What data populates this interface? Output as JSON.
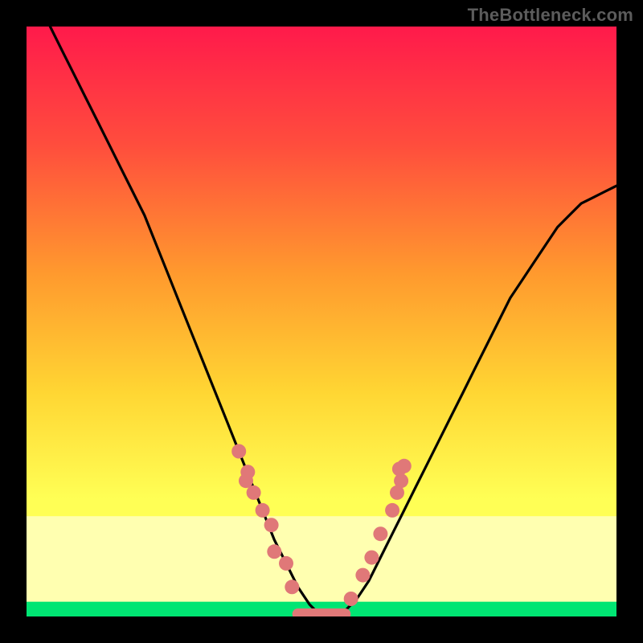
{
  "watermark": "TheBottleneck.com",
  "colors": {
    "frame_bg": "#000000",
    "grad_top": "#ff1a4b",
    "grad_mid_hi": "#ff7a33",
    "grad_mid": "#ffd633",
    "grad_low_yellow": "#ffff66",
    "grad_pale": "#ffffcc",
    "grad_green": "#00e573",
    "curve_stroke": "#000000",
    "band_stroke": "#e06e6e",
    "band_fill": "#e07878"
  },
  "chart_data": {
    "type": "line",
    "title": "",
    "xlabel": "",
    "ylabel": "",
    "xlim": [
      0,
      100
    ],
    "ylim": [
      0,
      100
    ],
    "grid": false,
    "legend": false,
    "series": [
      {
        "name": "bottleneck-curve",
        "x": [
          4,
          6,
          8,
          10,
          12,
          14,
          16,
          18,
          20,
          22,
          24,
          26,
          28,
          30,
          32,
          34,
          36,
          38,
          40,
          42,
          44,
          46,
          48,
          50,
          52,
          54,
          56,
          58,
          60,
          62,
          64,
          66,
          68,
          70,
          72,
          74,
          76,
          78,
          80,
          82,
          84,
          86,
          88,
          90,
          92,
          94,
          96,
          98,
          100
        ],
        "y": [
          100,
          96,
          92,
          88,
          84,
          80,
          76,
          72,
          68,
          63,
          58,
          53,
          48,
          43,
          38,
          33,
          28,
          23,
          18,
          13,
          9,
          5,
          2,
          0,
          0,
          1,
          3,
          6,
          10,
          14,
          18,
          22,
          26,
          30,
          34,
          38,
          42,
          46,
          50,
          54,
          57,
          60,
          63,
          66,
          68,
          70,
          71,
          72,
          73
        ]
      }
    ],
    "marker_clusters": [
      {
        "name": "left-cluster",
        "points": [
          {
            "x": 36,
            "y": 28
          },
          {
            "x": 37.5,
            "y": 24.5
          },
          {
            "x": 37.2,
            "y": 23
          },
          {
            "x": 38.5,
            "y": 21
          },
          {
            "x": 40,
            "y": 18
          },
          {
            "x": 41.5,
            "y": 15.5
          },
          {
            "x": 42,
            "y": 11
          },
          {
            "x": 44,
            "y": 9
          },
          {
            "x": 45,
            "y": 5
          }
        ]
      },
      {
        "name": "right-cluster",
        "points": [
          {
            "x": 55,
            "y": 3
          },
          {
            "x": 57,
            "y": 7
          },
          {
            "x": 58.5,
            "y": 10
          },
          {
            "x": 60,
            "y": 14
          },
          {
            "x": 62,
            "y": 18
          },
          {
            "x": 62.8,
            "y": 21
          },
          {
            "x": 63.5,
            "y": 23
          },
          {
            "x": 64,
            "y": 25.5
          },
          {
            "x": 63.2,
            "y": 25
          }
        ]
      }
    ],
    "flat_band": {
      "x_start": 46,
      "x_end": 54,
      "y": 0,
      "thickness": 2.5
    },
    "background_bands": [
      {
        "name": "pale-yellow",
        "y_from": 0,
        "y_to": 17,
        "color": "#ffffb0"
      },
      {
        "name": "green",
        "y_from": 0,
        "y_to": 2.5,
        "color": "#00e573"
      }
    ]
  }
}
